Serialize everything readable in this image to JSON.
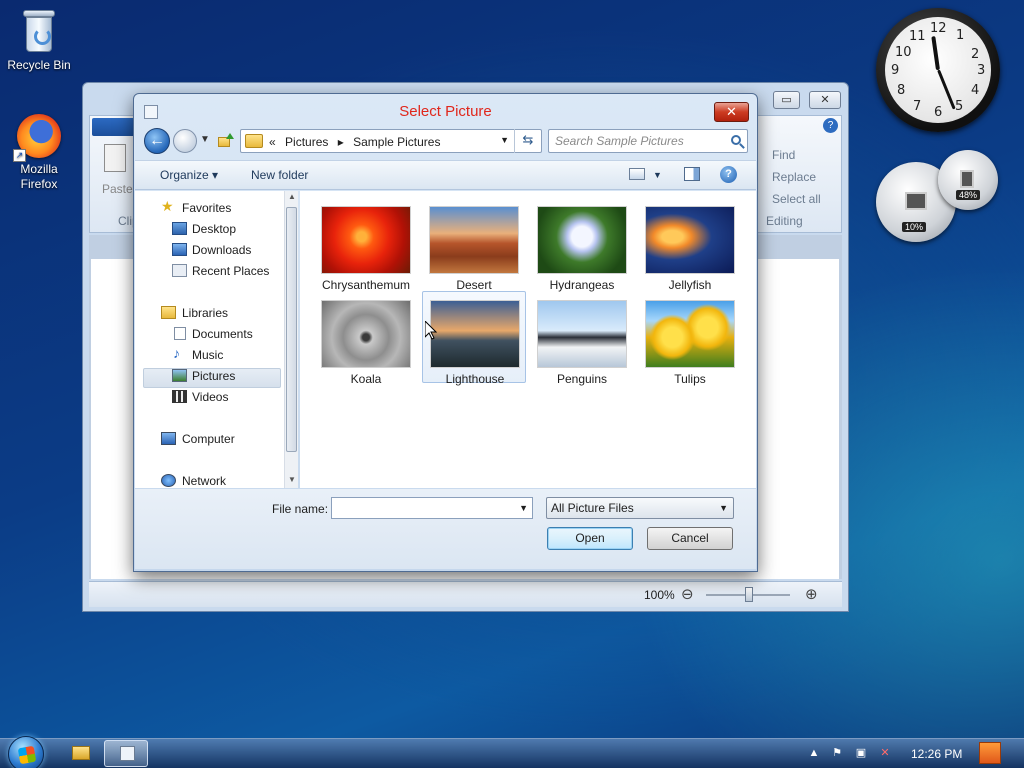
{
  "desktop": {
    "icons": [
      {
        "label": "Recycle Bin"
      },
      {
        "label": "Mozilla Firefox"
      }
    ]
  },
  "gadgets": {
    "clock_numbers": [
      "12",
      "1",
      "2",
      "3",
      "4",
      "5",
      "6",
      "7",
      "8",
      "9",
      "10",
      "11"
    ],
    "cpu_meter": {
      "cpu": "10%",
      "memory": "48%"
    }
  },
  "paint": {
    "ribbon": {
      "paste": "Paste",
      "clipboard": "Clip",
      "find": "Find",
      "replace": "Replace",
      "select_all": "Select all",
      "editing": "Editing"
    },
    "status": {
      "zoom": "100%",
      "zoom_out": "⊖",
      "zoom_in": "⊕"
    }
  },
  "dialog": {
    "title": "Select Picture",
    "close": "✕",
    "breadcrumb": [
      "«",
      "Pictures",
      "▸",
      "Sample Pictures"
    ],
    "search_placeholder": "Search Sample Pictures",
    "toolbar": {
      "organize": "Organize ▾",
      "new_folder": "New folder",
      "help": "?"
    },
    "nav": {
      "favorites": "Favorites",
      "favorites_items": [
        "Desktop",
        "Downloads",
        "Recent Places"
      ],
      "libraries": "Libraries",
      "libraries_items": [
        "Documents",
        "Music",
        "Pictures",
        "Videos"
      ],
      "computer": "Computer",
      "network": "Network",
      "selected": "Pictures"
    },
    "files": [
      "Chrysanthemum",
      "Desert",
      "Hydrangeas",
      "Jellyfish",
      "Koala",
      "Lighthouse",
      "Penguins",
      "Tulips"
    ],
    "selected_file": "Lighthouse",
    "file_name_label": "File name:",
    "file_name_value": "",
    "filter": "All Picture Files",
    "open": "Open",
    "cancel": "Cancel"
  },
  "taskbar": {
    "time": "12:26 PM"
  }
}
